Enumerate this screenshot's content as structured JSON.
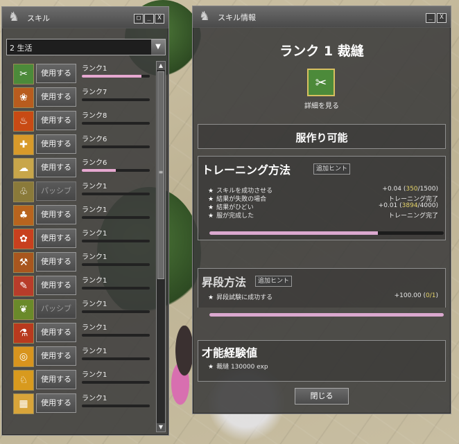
{
  "skill_window": {
    "title": "スキル",
    "buttons": [
      "□",
      "_",
      "X"
    ],
    "category": "2 生活",
    "skills": [
      {
        "icon": "sewing-icon",
        "use_label": "使用する",
        "rank": "ランク1",
        "progress": 0.88,
        "icon_color": "#4c8a3a",
        "passive": false
      },
      {
        "icon": "weaving-icon",
        "use_label": "使用する",
        "rank": "ランク7",
        "progress": 0.0,
        "icon_color": "#b85c1e",
        "passive": false
      },
      {
        "icon": "campfire-icon",
        "use_label": "使用する",
        "rank": "ランク8",
        "progress": 0.0,
        "icon_color": "#c84a14",
        "passive": false
      },
      {
        "icon": "first-aid-icon",
        "use_label": "使用する",
        "rank": "ランク6",
        "progress": 0.0,
        "icon_color": "#d89a2a",
        "passive": false
      },
      {
        "icon": "cooking-icon",
        "use_label": "使用する",
        "rank": "ランク6",
        "progress": 0.5,
        "icon_color": "#c8a64a",
        "passive": false
      },
      {
        "icon": "rest-icon",
        "use_label": "パッシブ",
        "rank": "ランク1",
        "progress": 0.0,
        "icon_color": "#8a7a3a",
        "passive": true
      },
      {
        "icon": "tree-icon",
        "use_label": "使用する",
        "rank": "ランク1",
        "progress": 0.0,
        "icon_color": "#b8641e",
        "passive": false
      },
      {
        "icon": "gathering-icon",
        "use_label": "使用する",
        "rank": "ランク1",
        "progress": 0.0,
        "icon_color": "#c8401e",
        "passive": false
      },
      {
        "icon": "smithing-icon",
        "use_label": "使用する",
        "rank": "ランク1",
        "progress": 0.0,
        "icon_color": "#a8561e",
        "passive": false
      },
      {
        "icon": "fishing-icon",
        "use_label": "使用する",
        "rank": "ランク1",
        "progress": 0.0,
        "icon_color": "#b83c2a",
        "passive": false
      },
      {
        "icon": "herbalism-icon",
        "use_label": "パッシブ",
        "rank": "ランク1",
        "progress": 0.0,
        "icon_color": "#6a8a2a",
        "passive": true
      },
      {
        "icon": "potion-icon",
        "use_label": "使用する",
        "rank": "ランク1",
        "progress": 0.0,
        "icon_color": "#b83a1e",
        "passive": false
      },
      {
        "icon": "milling-icon",
        "use_label": "使用する",
        "rank": "ランク1",
        "progress": 0.0,
        "icon_color": "#d8941e",
        "passive": false
      },
      {
        "icon": "taming-icon",
        "use_label": "使用する",
        "rank": "ランク1",
        "progress": 0.0,
        "icon_color": "#d89a1e",
        "passive": false
      },
      {
        "icon": "fishing-net-icon",
        "use_label": "使用する",
        "rank": "ランク1",
        "progress": 0.0,
        "icon_color": "#d8a43a",
        "passive": false
      }
    ]
  },
  "info_window": {
    "title": "スキル情報",
    "buttons": [
      "_",
      "X"
    ],
    "heading": "ランク 1 裁縫",
    "detail_label": "詳細を見る",
    "craftable": "服作り可能",
    "training": {
      "title": "トレーニング方法",
      "hint_label": "追加ヒント",
      "rows": [
        {
          "text": "スキルを成功させる",
          "value_prefix": "+0.04 (",
          "value_highlight": "350",
          "value_suffix": "/1500)"
        },
        {
          "text": "結果が失敗の場合",
          "value_prefix": "トレーニング完了",
          "value_highlight": "",
          "value_suffix": ""
        },
        {
          "text": "結果がひどい",
          "value_prefix": "+0.01 (",
          "value_highlight": "3894",
          "value_suffix": "/4000)"
        },
        {
          "text": "服が完成した",
          "value_prefix": "トレーニング完了",
          "value_highlight": "",
          "value_suffix": ""
        }
      ],
      "progress": 0.72
    },
    "promotion": {
      "title": "昇段方法",
      "hint_label": "追加ヒント",
      "rows": [
        {
          "text": "昇段試験に成功する",
          "value_prefix": "+100.00 (",
          "value_highlight": "0/1",
          "value_suffix": ")"
        }
      ],
      "progress": 1.0
    },
    "talent": {
      "title": "才能経験値",
      "rows": [
        {
          "text": "裁縫 130000 exp"
        }
      ]
    },
    "close_label": "閉じる",
    "star": "★"
  }
}
